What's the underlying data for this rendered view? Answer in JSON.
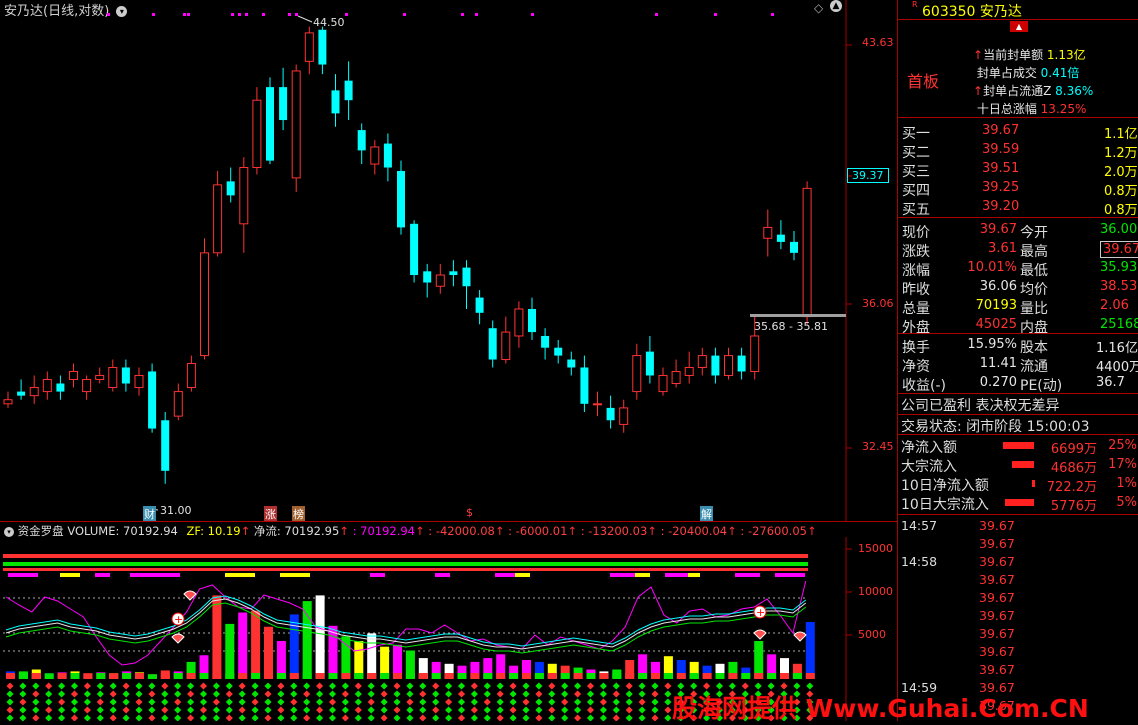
{
  "chart_title": "安乃达(日线,对数)",
  "main_axis": [
    "43.63",
    "39.37",
    "36.06",
    "32.45"
  ],
  "annotations": {
    "high": "44.50",
    "low": "31.00",
    "range": "35.68 - 35.81"
  },
  "markers": [
    "财",
    "涨",
    "榜",
    "解",
    "$"
  ],
  "indicator": {
    "name": "资金罗盘",
    "volume": "VOLUME: 70192.94",
    "zf": "ZF: 10.19",
    "jl": "净流: 70192.95",
    "v1": ": 70192.94",
    "v2": ": -42000.08",
    "v3": ": -6000.01",
    "v4": ": -13200.03",
    "v5": ": -20400.04",
    "v6": ": -27600.05"
  },
  "sub_axis": [
    "15000",
    "10000",
    "5000"
  ],
  "stock": {
    "code": "603350",
    "name": "安乃达",
    "board": "首板",
    "seal": [
      {
        "label": "当前封单额",
        "value": "1.13亿",
        "color": "yel"
      },
      {
        "label": "封单占成交",
        "value": "0.41倍",
        "color": "cyn"
      },
      {
        "label": "封单占流通Z",
        "value": "8.36%",
        "color": "cyn"
      },
      {
        "label": "十日总涨幅",
        "value": "13.25%",
        "color": "red"
      }
    ]
  },
  "order_book": [
    {
      "label": "买一",
      "price": "39.67",
      "vol": "1.1亿"
    },
    {
      "label": "买二",
      "price": "39.59",
      "vol": "1.2万"
    },
    {
      "label": "买三",
      "price": "39.51",
      "vol": "2.0万"
    },
    {
      "label": "买四",
      "price": "39.25",
      "vol": "0.8万"
    },
    {
      "label": "买五",
      "price": "39.20",
      "vol": "0.8万"
    }
  ],
  "quote": [
    {
      "l": "现价",
      "v": "39.67",
      "vc": "red",
      "l2": "今开",
      "v2": "36.00",
      "v2c": "grn"
    },
    {
      "l": "涨跌",
      "v": "3.61",
      "vc": "red",
      "l2": "最高",
      "v2": "39.67",
      "v2c": "red"
    },
    {
      "l": "涨幅",
      "v": "10.01%",
      "vc": "red",
      "l2": "最低",
      "v2": "35.93",
      "v2c": "grn"
    },
    {
      "l": "昨收",
      "v": "36.06",
      "vc": "wht",
      "l2": "均价",
      "v2": "38.53",
      "v2c": "red"
    },
    {
      "l": "总量",
      "v": "70193",
      "vc": "yel",
      "l2": "量比",
      "v2": "2.06",
      "v2c": "red"
    },
    {
      "l": "外盘",
      "v": "45025",
      "vc": "red",
      "l2": "内盘",
      "v2": "25168",
      "v2c": "grn"
    }
  ],
  "quote2": [
    {
      "l": "换手",
      "v": "15.95%",
      "l2": "股本",
      "v2": "1.16亿"
    },
    {
      "l": "净资",
      "v": "11.41",
      "l2": "流通",
      "v2": "4400万"
    },
    {
      "l": "收益(-)",
      "v": "0.270",
      "l2": "PE(动)",
      "v2": "36.7"
    }
  ],
  "status_lines": [
    "公司已盈利 表决权无差异",
    "交易状态: 闭市阶段 15:00:03"
  ],
  "flows": [
    {
      "label": "净流入额",
      "value": "6699万",
      "pct": "25%",
      "bar": 0.85
    },
    {
      "label": "大宗流入",
      "value": "4686万",
      "pct": "17%",
      "bar": 0.6
    },
    {
      "label": "10日净流入额",
      "value": "722.2万",
      "pct": "1%",
      "bar": 0.05
    },
    {
      "label": "10日大宗流入",
      "value": "5776万",
      "pct": "5%",
      "bar": 0.8
    }
  ],
  "ticks": [
    {
      "time": "14:57",
      "price": "39.67"
    },
    {
      "time": "",
      "price": "39.67"
    },
    {
      "time": "14:58",
      "price": "39.67"
    },
    {
      "time": "",
      "price": "39.67"
    },
    {
      "time": "",
      "price": "39.67"
    },
    {
      "time": "",
      "price": "39.67"
    },
    {
      "time": "",
      "price": "39.67"
    },
    {
      "time": "",
      "price": "39.67"
    },
    {
      "time": "",
      "price": "39.67"
    },
    {
      "time": "14:59",
      "price": "39.67"
    },
    {
      "time": "",
      "price": "39.67"
    }
  ],
  "watermark": "股海网提供 Www.Guhai.Com.CN"
}
